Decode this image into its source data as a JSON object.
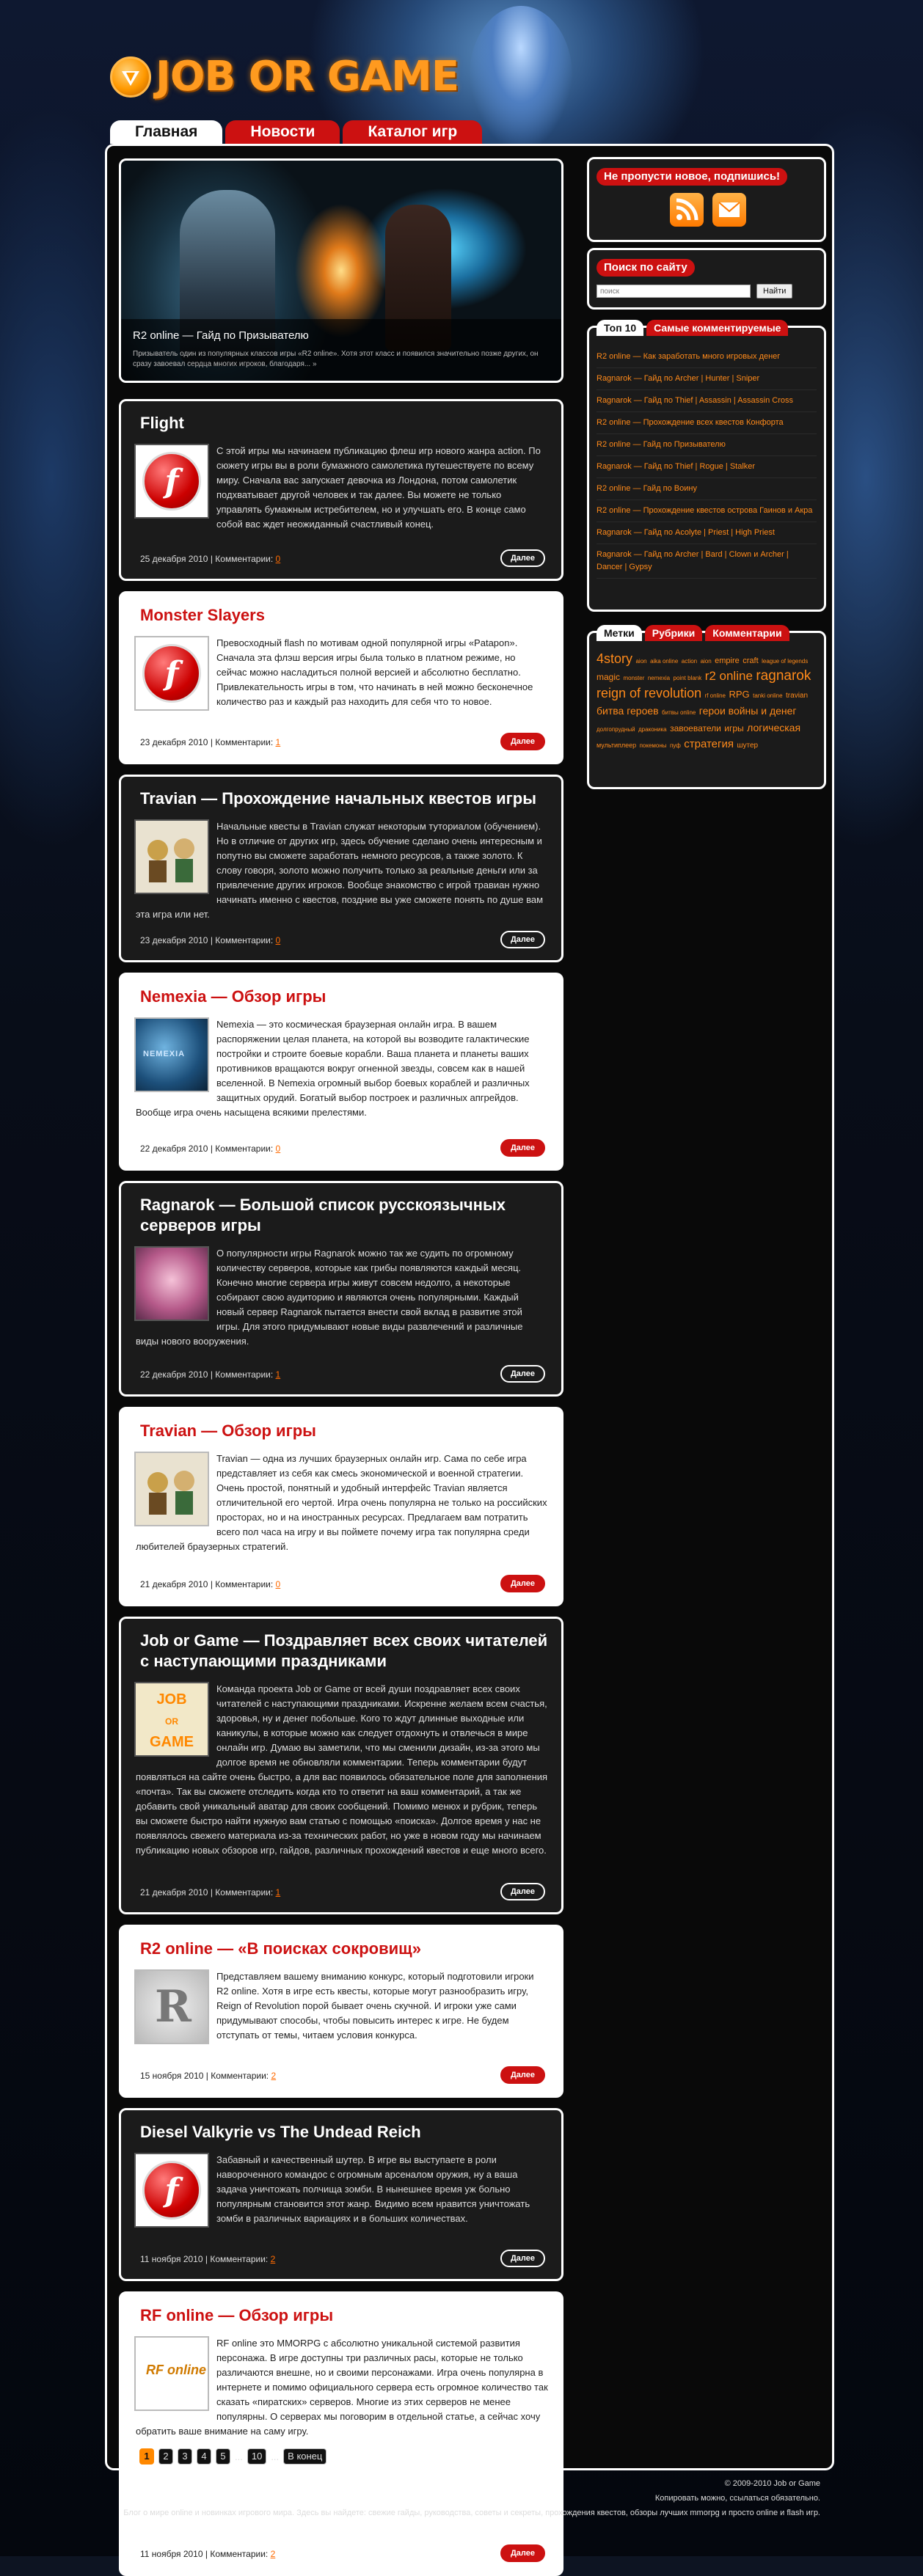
{
  "site": {
    "logo_text": "JOB OR GAME",
    "nav": [
      "Главная",
      "Новости",
      "Каталог игр"
    ]
  },
  "slider": {
    "title": "R2 online — Гайд по Призывателю",
    "text": "Призыватель один из популярных классов игры «R2 online». Хотя этот класс и появился значительно позже других, он сразу завоевал сердца многих игроков, благодаря... »"
  },
  "posts": [
    {
      "title": "Flight",
      "excerpt": "С этой игры мы начинаем публикацию флеш игр нового жанра action. По сюжету игры вы в роли бумажного самолетика путешествуете по всему миру. Сначала вас запускает девочка из Лондона, потом самолетик подхватывает другой человек и так далее. Вы можете не только управлять бумажным истребителем, но и улучшать его. В конце само собой вас ждет неожиданный счастливый конец.",
      "date": "25 декабря 2010",
      "comments_label": "Комментарии:",
      "comments": "0",
      "more": "Далее"
    },
    {
      "title": "Monster Slayers",
      "excerpt": "Превосходный flash по мотивам одной популярной игры «Patapon». Сначала эта флэш версия игры была только в платном режиме, но сейчас можно насладиться полной версией и абсолютно бесплатно. Привлекательность игры в том, что начинать в ней можно бесконечное количество раз и каждый раз находить для себя что то новое.",
      "date": "23 декабря 2010",
      "comments_label": "Комментарии:",
      "comments": "1",
      "more": "Далее"
    },
    {
      "title": "Travian — Прохождение начальных квестов игры",
      "excerpt": "Начальные квесты в Travian служат некоторым туториалом (обучением). Но в отличие от других игр, здесь обучение сделано очень интересным и попутно вы сможете заработать немного ресурсов, а также золото. К слову говоря, золото можно получить только за реальные деньги или за привлечение других игроков. Вообще знакомство с игрой травиан нужно начинать именно с квестов, поздние вы уже сможете понять по душе вам эта игра или нет.",
      "date": "23 декабря 2010",
      "comments_label": "Комментарии:",
      "comments": "0",
      "more": "Далее"
    },
    {
      "title": "Nemexia — Обзор игры",
      "excerpt": "Nemexia — это космическая браузерная онлайн игра. В вашем распоряжении целая планета, на которой вы возводите галактические постройки и строите боевые корабли. Ваша планета и планеты ваших противников вращаются вокруг огненной звезды, совсем как в нашей вселенной. В Nemexia огромный выбор боевых кораблей и различных защитных орудий. Богатый выбор построек и различных апгрейдов. Вообще игра очень насыщена всякими прелестями.",
      "date": "22 декабря 2010",
      "comments_label": "Комментарии:",
      "comments": "0",
      "more": "Далее"
    },
    {
      "title": "Ragnarok — Большой список русскоязычных серверов игры",
      "excerpt": "О популярности игры Ragnarok можно так же судить по огромному количеству серверов, которые как грибы появляются каждый месяц. Конечно многие сервера игры живут совсем недолго, а некоторые собирают свою аудиторию и являются очень популярными. Каждый новый сервер Ragnarok пытается внести свой вклад в развитие этой игры. Для этого придумывают новые виды развлечений и различные виды нового вооружения.",
      "date": "22 декабря 2010",
      "comments_label": "Комментарии:",
      "comments": "1",
      "more": "Далее"
    },
    {
      "title": "Travian — Обзор игры",
      "excerpt": "Travian — одна из лучших браузерных онлайн игр. Сама по себе игра представляет из себя как смесь экономической и военной стратегии. Очень простой, понятный и удобный интерфейс Travian является отличительной его чертой. Игра очень популярна не только на российских просторах, но и на иностранных ресурсах. Предлагаем вам потратить всего пол часа на игру и вы поймете почему игра так популярна среди любителей браузерных стратегий.",
      "date": "21 декабря 2010",
      "comments_label": "Комментарии:",
      "comments": "0",
      "more": "Далее"
    },
    {
      "title": "Job or Game — Поздравляет всех своих читателей с наступающими праздниками",
      "excerpt": "Команда проекта Job or Game от всей души поздравляет всех своих читателей с наступающими праздниками. Искренне желаем всем счастья, здоровья, ну и денег побольше. Кого то ждут длинные выходные или каникулы, в которые можно как следует отдохнуть и отвлечься в мире онлайн игр. Думаю вы заметили, что мы сменили дизайн, из-за этого мы долгое время не обновляли комментарии. Теперь комментарии будут появляться на сайте очень быстро, а для вас появилось обязательное поле для заполнения «почта». Так вы сможете отследить когда кто то ответит на ваш комментарий, а так же добавить свой уникальный аватар для своих сообщений. Помимо менюх и рубрик, теперь вы сможете быстро найти нужную вам статью с помощью «поиска». Долгое время у нас не появлялось свежего материала из-за технических работ, но уже в новом году мы начинаем публикацию новых обзоров игр, гайдов, различных прохождений квестов и еще много всего.",
      "date": "21 декабря 2010",
      "comments_label": "Комментарии:",
      "comments": "1",
      "more": "Далее"
    },
    {
      "title": "R2 online — «В поисках сокровищ»",
      "excerpt": "Представляем вашему вниманию конкурс, который подготовили игроки R2 online. Хотя в игре есть квесты, которые могут разнообразить игру, Reign of Revolution порой бывает очень скучной. И игроки уже сами придумывают способы, чтобы повысить интерес к игре. Не будем отступать от темы, читаем условия конкурса.",
      "date": "15 ноября 2010",
      "comments_label": "Комментарии:",
      "comments": "2",
      "more": "Далее"
    },
    {
      "title": "Diesel Valkyrie vs The Undead Reich",
      "excerpt": "Забавный и качественный шутер. В игре вы выступаете в роли навороченного командос с огромным арсеналом оружия, ну а ваша задача уничтожать полчища зомби. В нынешнее время уж больно популярным становится этот жанр. Видимо всем нравится уничтожать зомби в различных вариациях и в больших количествах.",
      "date": "11 ноября 2010",
      "comments_label": "Комментарии:",
      "comments": "2",
      "more": "Далее"
    },
    {
      "title": "RF online — Обзор игры",
      "excerpt": "RF online это MMORPG с абсолютно уникальной системой развития персонажа. В игре доступны три различных расы, которые не только различаются внешне, но и своими персонажами. Игра очень популярна в интернете и помимо официального сервера есть огромное количество так сказать «пиратских» серверов. Многие из этих серверов не менее популярны. О серверах мы поговорим в отдельной статье, а сейчас хочу обратить ваше внимание на саму игру.",
      "date": "11 ноября 2010",
      "comments_label": "Комментарии:",
      "comments": "2",
      "more": "Далее"
    }
  ],
  "pagination": {
    "pages": [
      "1",
      "2",
      "3",
      "4",
      "5"
    ],
    "dots": "...",
    "last_num": "10",
    "dots2": "...",
    "last": "В конец"
  },
  "sidebar": {
    "subscribe_title": "Не пропусти новое, подпишись!",
    "search_title": "Поиск по сайту",
    "search_placeholder": "поиск",
    "search_button": "Найти",
    "tabs1": [
      "Топ 10",
      "Самые комментируемые"
    ],
    "top10": [
      "R2 online — Как заработать много игровых денег",
      "Ragnarok — Гайд по Archer | Hunter | Sniper",
      "Ragnarok — Гайд по Thief | Assassin | Assassin Cross",
      "R2 online — Прохождение всех квестов Конфорта",
      "R2 online — Гайд по Призывателю",
      "Ragnarok — Гайд по Thief | Rogue | Stalker",
      "R2 online — Гайд по Воину",
      "R2 online — Прохождение квестов острова Гаинов и Акра",
      "Ragnarok — Гайд по Acolyte | Priest | High Priest",
      "Ragnarok — Гайд по Archer | Bard | Clown и Archer | Dancer | Gypsy"
    ],
    "tabs2": [
      "Метки",
      "Рубрики",
      "Комментарии"
    ],
    "tags": [
      "4story",
      "aion",
      "aika online",
      "action",
      "aion",
      "empire",
      "craft",
      "league of legends",
      "magic",
      "monster",
      "nemexia",
      "point blank",
      "r2 online",
      "ragnarok",
      "reign of revolution",
      "rf online",
      "RPG",
      "tanki online",
      "travian",
      "битва героев",
      "битвы online",
      "герои войны и денег",
      "долгопрудный",
      "драконика",
      "завоеватели",
      "игры",
      "логическая",
      "мультиплеер",
      "покемоны",
      "пуф",
      "стратегия",
      "шутер"
    ]
  },
  "footer": {
    "line1": "© 2009-2010 Job or Game",
    "line2": "Копировать можно, ссылаться обязательно.",
    "line3": "Блог о мире online и новинках игрового мира. Здесь вы найдете: свежие гайды, руководства, советы и секреты, прохождения квестов, обзоры лучших mmorpg и просто online и flash игр."
  }
}
